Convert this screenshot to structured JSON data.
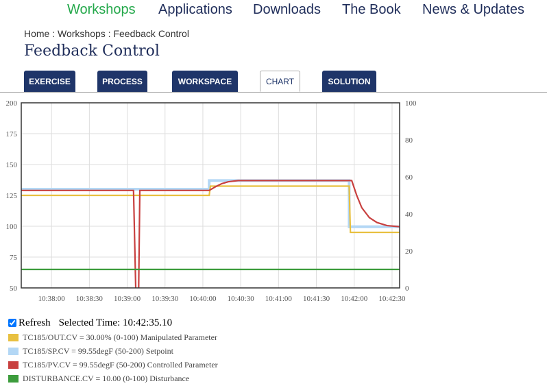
{
  "nav": [
    {
      "label": "Workshops",
      "active": true
    },
    {
      "label": "Applications"
    },
    {
      "label": "Downloads"
    },
    {
      "label": "The Book"
    },
    {
      "label": "News & Updates"
    }
  ],
  "breadcrumb": "Home : Workshops : Feedback Control",
  "page_title": "Feedback Control",
  "tabs": [
    {
      "label": "EXERCISE"
    },
    {
      "label": "PROCESS"
    },
    {
      "label": "WORKSPACE"
    },
    {
      "label": "CHART",
      "active": true
    },
    {
      "label": "SOLUTION"
    }
  ],
  "colors": {
    "nav_active": "#23a84a",
    "nav": "#1f2d5a",
    "tab": "#1f3569",
    "out": "#e8c040",
    "sp": "#b3d7f5",
    "pv": "#c8403f",
    "dist": "#3c9c3c"
  },
  "chart_data": {
    "type": "line",
    "xlim": [
      "10:37:36",
      "10:42:36"
    ],
    "x_ticks": [
      "10:38:00",
      "10:38:30",
      "10:39:00",
      "10:39:30",
      "10:40:00",
      "10:40:30",
      "10:41:00",
      "10:41:30",
      "10:42:00",
      "10:42:30"
    ],
    "ylim_left": [
      50,
      200
    ],
    "y_ticks_left": [
      50,
      75,
      100,
      125,
      150,
      175,
      200
    ],
    "ylim_right": [
      0,
      100
    ],
    "y_ticks_right": [
      0,
      20,
      40,
      60,
      80,
      100
    ],
    "grid": true,
    "series": [
      {
        "key": "sp",
        "axis": "left",
        "color": "#b3d7f5",
        "points": [
          [
            "10:37:36",
            130
          ],
          [
            "10:40:05",
            130
          ],
          [
            "10:40:05",
            137
          ],
          [
            "10:41:56",
            137
          ],
          [
            "10:41:56",
            99.55
          ],
          [
            "10:42:36",
            99.55
          ]
        ]
      },
      {
        "key": "out",
        "axis": "right",
        "color": "#e8c040",
        "points": [
          [
            "10:37:36",
            50
          ],
          [
            "10:40:05",
            50
          ],
          [
            "10:40:06",
            55
          ],
          [
            "10:41:56",
            55
          ],
          [
            "10:41:57",
            30
          ],
          [
            "10:42:36",
            30
          ]
        ]
      },
      {
        "key": "pv",
        "axis": "left",
        "color": "#c8403f",
        "points": [
          [
            "10:37:36",
            129
          ],
          [
            "10:39:05",
            129
          ],
          [
            "10:39:07",
            40
          ],
          [
            "10:39:09",
            40
          ],
          [
            "10:39:10",
            129
          ],
          [
            "10:40:05",
            129
          ],
          [
            "10:40:10",
            132
          ],
          [
            "10:40:15",
            134.5
          ],
          [
            "10:40:20",
            136
          ],
          [
            "10:40:28",
            137
          ],
          [
            "10:41:58",
            137
          ],
          [
            "10:42:02",
            125
          ],
          [
            "10:42:06",
            115
          ],
          [
            "10:42:12",
            107
          ],
          [
            "10:42:18",
            103
          ],
          [
            "10:42:26",
            100.5
          ],
          [
            "10:42:36",
            99.6
          ]
        ]
      },
      {
        "key": "dist",
        "axis": "right",
        "color": "#3c9c3c",
        "points": [
          [
            "10:37:36",
            10
          ],
          [
            "10:42:36",
            10
          ]
        ]
      }
    ]
  },
  "legend": {
    "refresh_label": "Refresh",
    "refresh_checked": true,
    "selected_time": "Selected Time: 10:42:35.10",
    "items": [
      {
        "color": "#e8c040",
        "text": "TC185/OUT.CV = 30.00% (0-100) Manipulated Parameter"
      },
      {
        "color": "#b3d7f5",
        "text": "TC185/SP.CV = 99.55degF (50-200) Setpoint"
      },
      {
        "color": "#c8403f",
        "text": "TC185/PV.CV = 99.55degF (50-200) Controlled Parameter"
      },
      {
        "color": "#3c9c3c",
        "text": "DISTURBANCE.CV = 10.00 (0-100) Disturbance"
      }
    ]
  }
}
